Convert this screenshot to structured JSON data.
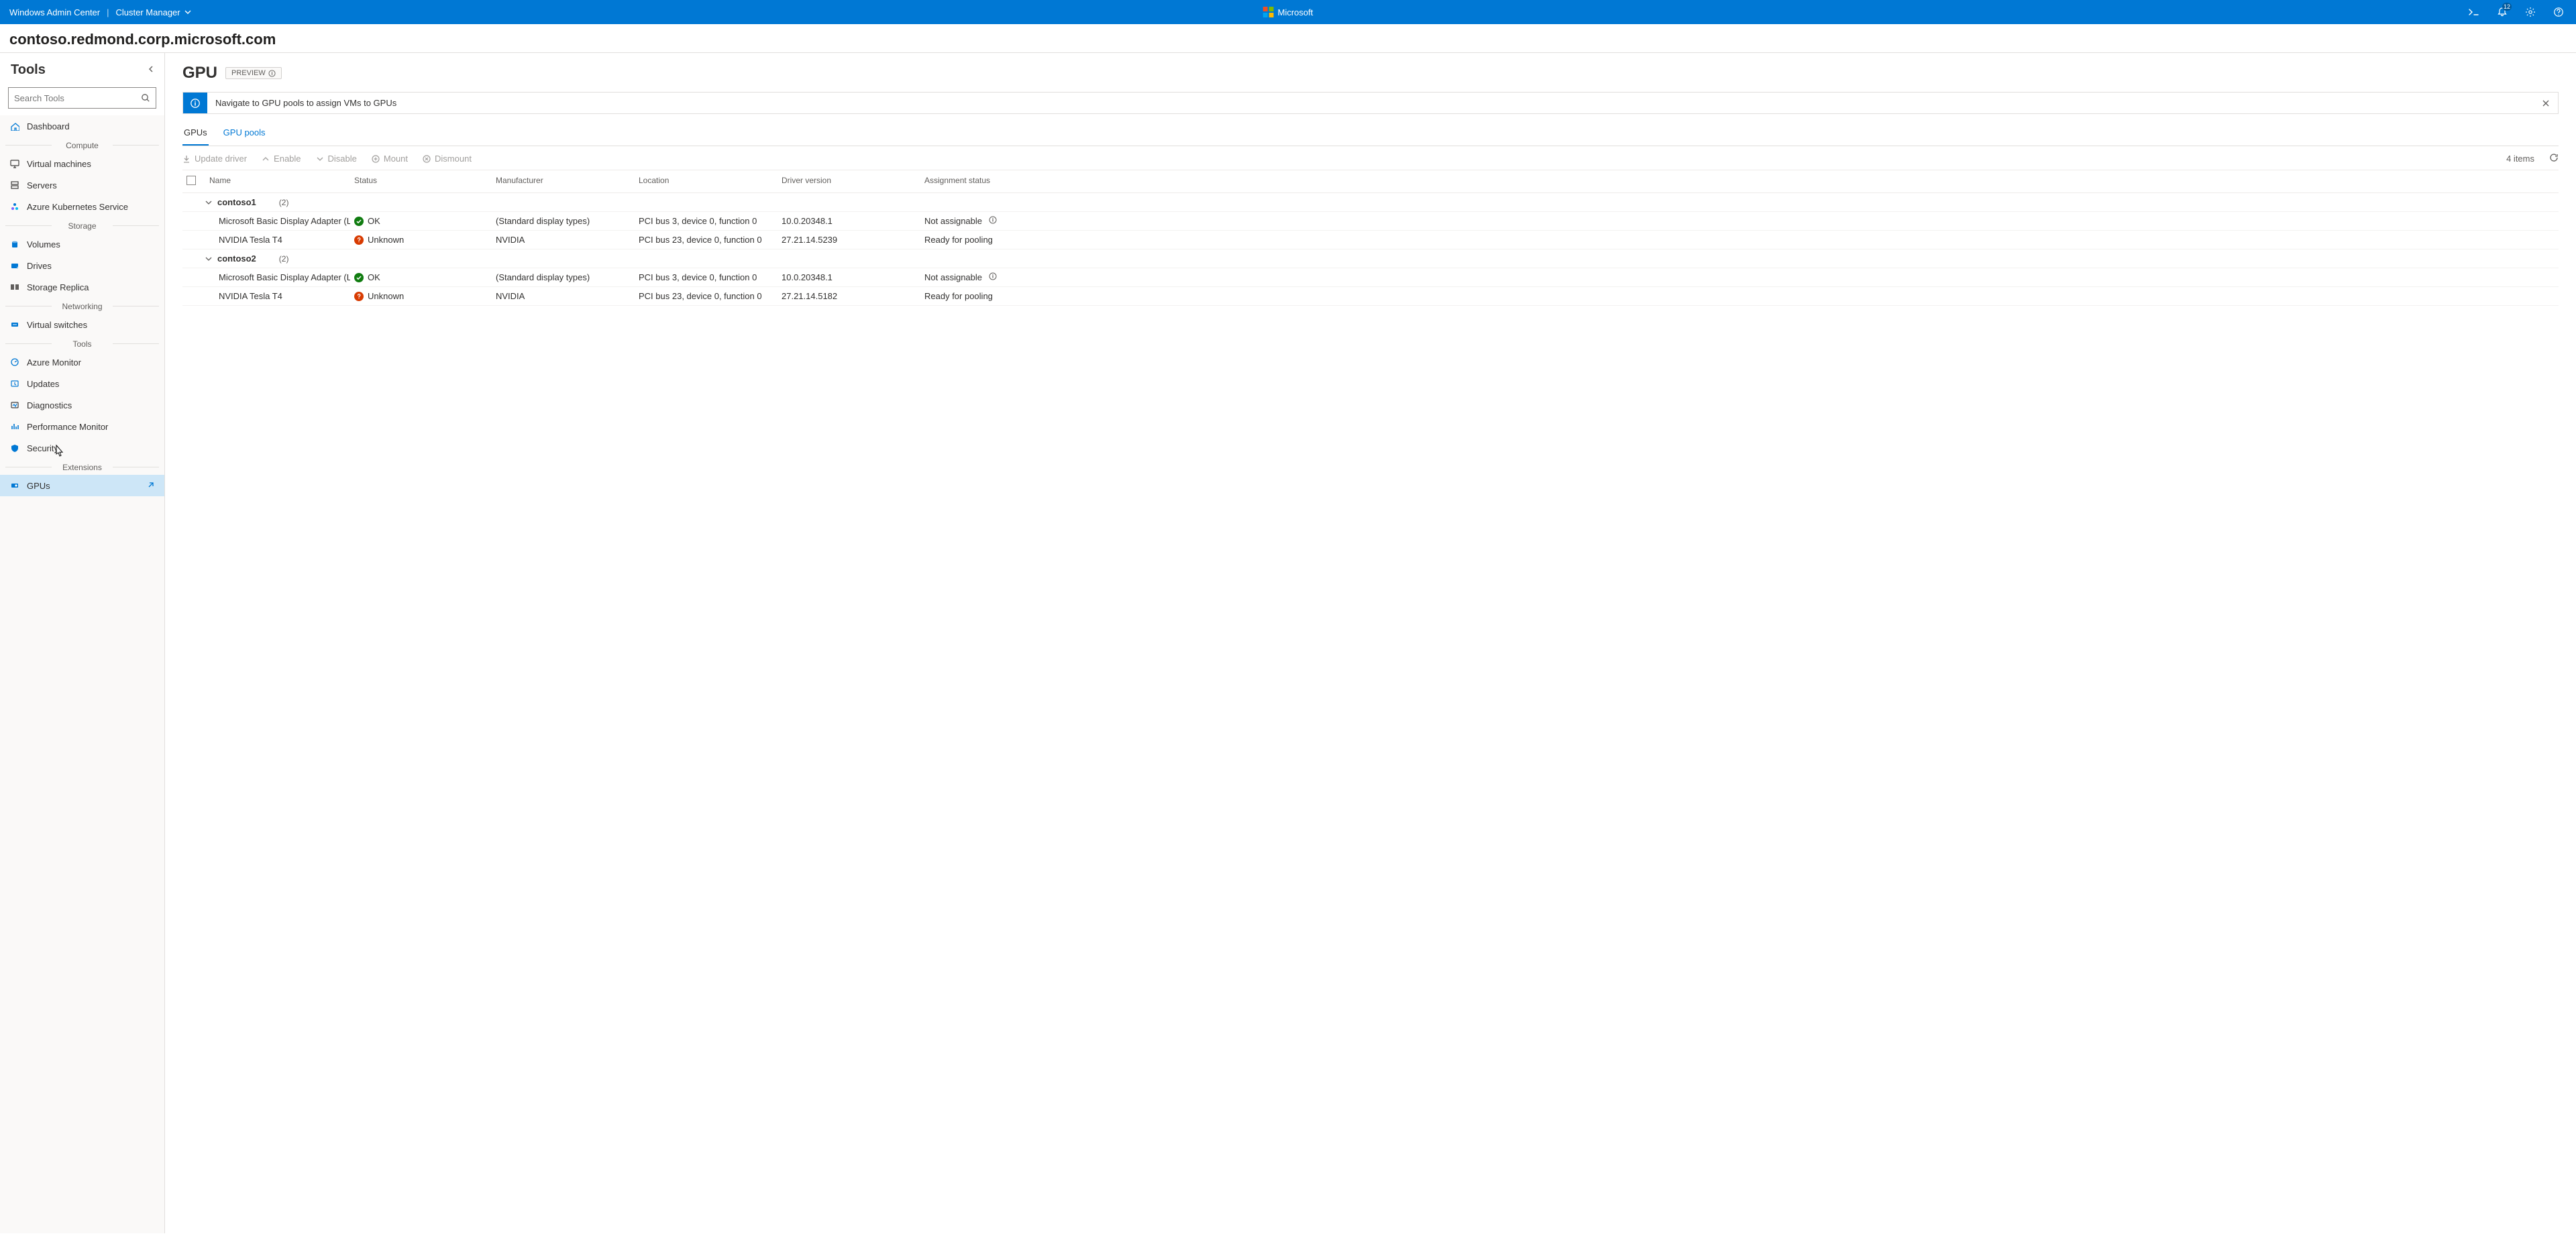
{
  "topbar": {
    "product": "Windows Admin Center",
    "context": "Cluster Manager",
    "center_brand": "Microsoft",
    "notification_count": "12"
  },
  "host": "contoso.redmond.corp.microsoft.com",
  "sidebar": {
    "title": "Tools",
    "search_placeholder": "Search Tools",
    "groups": [
      {
        "label": "",
        "items": [
          {
            "key": "dashboard",
            "label": "Dashboard",
            "icon": "home-icon"
          }
        ]
      },
      {
        "label": "Compute",
        "items": [
          {
            "key": "vms",
            "label": "Virtual machines",
            "icon": "vm-icon"
          },
          {
            "key": "servers",
            "label": "Servers",
            "icon": "server-icon"
          },
          {
            "key": "aks",
            "label": "Azure Kubernetes Service",
            "icon": "aks-icon"
          }
        ]
      },
      {
        "label": "Storage",
        "items": [
          {
            "key": "volumes",
            "label": "Volumes",
            "icon": "volume-icon"
          },
          {
            "key": "drives",
            "label": "Drives",
            "icon": "drive-icon"
          },
          {
            "key": "storage-replica",
            "label": "Storage Replica",
            "icon": "replica-icon"
          }
        ]
      },
      {
        "label": "Networking",
        "items": [
          {
            "key": "vswitch",
            "label": "Virtual switches",
            "icon": "switch-icon"
          }
        ]
      },
      {
        "label": "Tools",
        "items": [
          {
            "key": "azure-monitor",
            "label": "Azure Monitor",
            "icon": "monitor-icon"
          },
          {
            "key": "updates",
            "label": "Updates",
            "icon": "updates-icon"
          },
          {
            "key": "diagnostics",
            "label": "Diagnostics",
            "icon": "diag-icon"
          },
          {
            "key": "perfmon",
            "label": "Performance Monitor",
            "icon": "perf-icon"
          },
          {
            "key": "security",
            "label": "Security",
            "icon": "shield-icon"
          }
        ]
      },
      {
        "label": "Extensions",
        "items": [
          {
            "key": "gpus",
            "label": "GPUs",
            "icon": "gpu-icon",
            "active": true,
            "ext": true
          }
        ]
      }
    ]
  },
  "main": {
    "title": "GPU",
    "preview_label": "PREVIEW",
    "banner": "Navigate to GPU pools to assign VMs to GPUs",
    "tabs": [
      {
        "key": "gpus",
        "label": "GPUs",
        "active": true
      },
      {
        "key": "pools",
        "label": "GPU pools"
      }
    ],
    "commands": {
      "update_driver": "Update driver",
      "enable": "Enable",
      "disable": "Disable",
      "mount": "Mount",
      "dismount": "Dismount"
    },
    "item_count_label": "4 items",
    "columns": {
      "name": "Name",
      "status": "Status",
      "manufacturer": "Manufacturer",
      "location": "Location",
      "driver": "Driver version",
      "assign": "Assignment status"
    },
    "groups": [
      {
        "name": "contoso1",
        "count": "(2)",
        "rows": [
          {
            "name": "Microsoft Basic Display Adapter (Low Resolu...",
            "status": "OK",
            "status_kind": "ok",
            "manufacturer": "(Standard display types)",
            "location": "PCI bus 3, device 0, function 0",
            "driver": "10.0.20348.1",
            "assign": "Not assignable",
            "assign_info": true
          },
          {
            "name": "NVIDIA Tesla T4",
            "status": "Unknown",
            "status_kind": "unk",
            "manufacturer": "NVIDIA",
            "location": "PCI bus 23, device 0, function 0",
            "driver": "27.21.14.5239",
            "assign": "Ready for pooling"
          }
        ]
      },
      {
        "name": "contoso2",
        "count": "(2)",
        "rows": [
          {
            "name": "Microsoft Basic Display Adapter (Low Resolu...",
            "status": "OK",
            "status_kind": "ok",
            "manufacturer": "(Standard display types)",
            "location": "PCI bus 3, device 0, function 0",
            "driver": "10.0.20348.1",
            "assign": "Not assignable",
            "assign_info": true
          },
          {
            "name": "NVIDIA Tesla T4",
            "status": "Unknown",
            "status_kind": "unk",
            "manufacturer": "NVIDIA",
            "location": "PCI bus 23, device 0, function 0",
            "driver": "27.21.14.5182",
            "assign": "Ready for pooling"
          }
        ]
      }
    ]
  }
}
